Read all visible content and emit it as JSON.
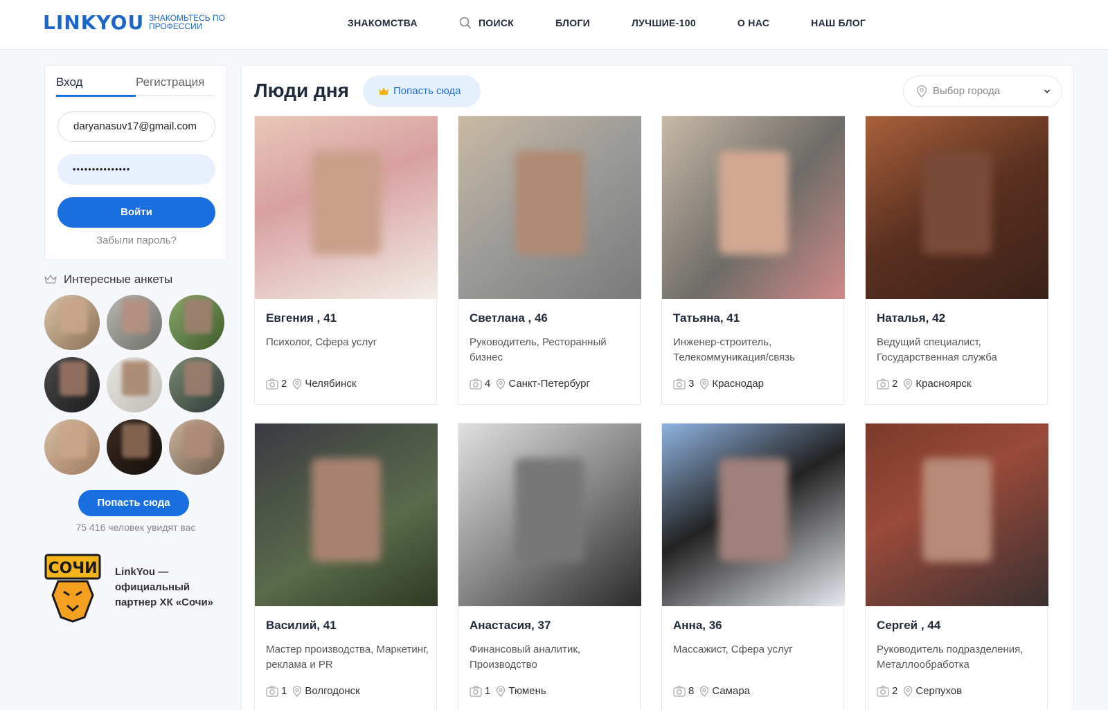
{
  "header": {
    "logo": "LINKYOU",
    "tagline": "Знакомьтесь по профессии",
    "nav": [
      "ЗНАКОМСТВА",
      "ПОИСК",
      "БЛОГИ",
      "ЛУЧШИЕ-100",
      "О НАС",
      "НАШ БЛОГ"
    ]
  },
  "login": {
    "tab_login": "Вход",
    "tab_register": "Регистрация",
    "email_value": "daryanasuv17@gmail.com",
    "password_mask": "•••••••••••••••",
    "login_button": "Войти",
    "forgot_link": "Забыли пароль?"
  },
  "sidebar": {
    "interesting_title": "Интересные анкеты",
    "get_here_button": "Попасть сюда",
    "viewers_text": "75 416 человек увидят вас",
    "partner_text": "LinkYou — официальный партнер ХК «Сочи»",
    "sochi_logo_text": "СОЧИ"
  },
  "main": {
    "title": "Люди дня",
    "get_here_pill": "Попасть сюда",
    "city_select_placeholder": "Выбор города",
    "people": [
      {
        "name": "Евгения , 41",
        "profession": "Психолог, Сфера услуг",
        "photos": "2",
        "city": "Челябинск"
      },
      {
        "name": "Светлана , 46",
        "profession": "Руководитель, Ресторанный бизнес",
        "photos": "4",
        "city": "Санкт-Петербург"
      },
      {
        "name": "Татьяна, 41",
        "profession": "Инженер-строитель, Телекоммуникация/связь",
        "photos": "3",
        "city": "Краснодар"
      },
      {
        "name": "Наталья, 42",
        "profession": "Ведущий специалист, Государственная служба",
        "photos": "2",
        "city": "Красноярск"
      },
      {
        "name": "Василий, 41",
        "profession": "Мастер производства, Маркетинг, реклама и PR",
        "photos": "1",
        "city": "Волгодонск"
      },
      {
        "name": "Анастасия, 37",
        "profession": "Финансовый аналитик, Производство",
        "photos": "1",
        "city": "Тюмень"
      },
      {
        "name": "Анна, 36",
        "profession": "Массажист, Сфера услуг",
        "photos": "8",
        "city": "Самара"
      },
      {
        "name": "Сергей , 44",
        "profession": "Руководитель подразделения, Металлообработка",
        "photos": "2",
        "city": "Серпухов"
      }
    ]
  },
  "colors": {
    "brand_blue": "#1a6fe0",
    "pill_bg": "#e5f0fd"
  }
}
